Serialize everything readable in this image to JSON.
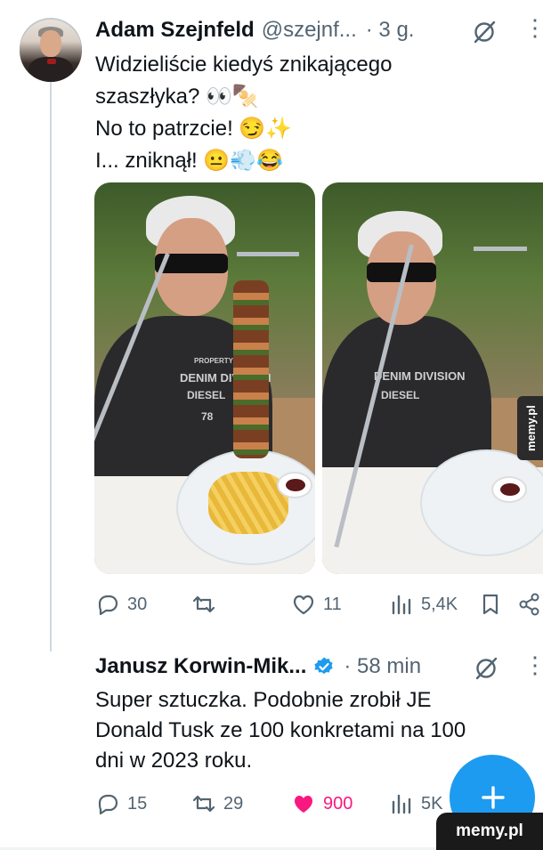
{
  "tweet1": {
    "author_name": "Adam Szejnfeld",
    "handle": "@szejnf...",
    "time": "· 3 g.",
    "text_lines": [
      "Widzieliście kiedyś znikającego",
      "szaszłyka? 👀🍢",
      "No to patrzcie! 😏✨",
      "I... zniknął! 😐💨😂"
    ],
    "actions": {
      "replies": "30",
      "reposts": "",
      "likes": "11",
      "views": "5,4K"
    },
    "photo_print": [
      "PROPERTY OF",
      "DENIM DIVISION",
      "DIESEL",
      "78"
    ]
  },
  "tweet2": {
    "author_name": "Janusz Korwin-Mik...",
    "time": "· 58 min",
    "text_lines": [
      "Super sztuczka. Podobnie zrobił JE",
      "Donald Tusk ze 100 konkretami na 100",
      "dni w 2023 roku."
    ],
    "actions": {
      "replies": "15",
      "reposts": "29",
      "likes": "900",
      "views": "5K"
    }
  },
  "watermark": {
    "side": "memy.pl",
    "corner": "memy.pl"
  },
  "colors": {
    "accent": "#1d9bf0",
    "like": "#f91880",
    "muted": "#536471"
  },
  "icons": [
    "grok-icon",
    "more-icon",
    "reply-icon",
    "repost-icon",
    "like-icon",
    "views-icon",
    "bookmark-icon",
    "share-icon",
    "verified-icon",
    "compose-plus-icon"
  ]
}
